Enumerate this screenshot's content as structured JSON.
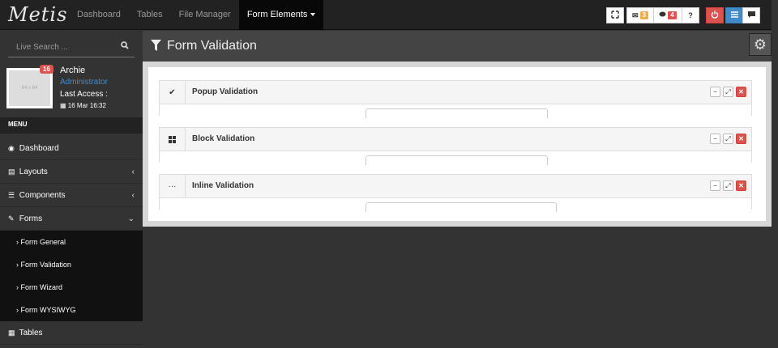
{
  "brand": {
    "logo_text": "Metis"
  },
  "nav": {
    "links": [
      {
        "label": "Dashboard"
      },
      {
        "label": "Tables"
      },
      {
        "label": "File Manager"
      },
      {
        "label": "Form Elements"
      }
    ],
    "toolbar": {
      "mail_count": "3",
      "comment_count": "4",
      "help_label": "?"
    }
  },
  "sidebar": {
    "search_placeholder": "Live Search ...",
    "user": {
      "name": "Archie",
      "role": "Administrator",
      "last_access_label": "Last Access :",
      "date": "16 Mar 16:32",
      "notification_count": "16",
      "avatar_text": "64 x 64"
    },
    "menu_header": "MENU",
    "items": [
      {
        "label": "Dashboard",
        "icon": "dashboard-icon"
      },
      {
        "label": "Layouts",
        "icon": "layouts-icon"
      },
      {
        "label": "Components",
        "icon": "components-icon"
      },
      {
        "label": "Forms",
        "icon": "pencil-icon"
      },
      {
        "label": "Tables",
        "icon": "table-icon"
      }
    ],
    "forms_submenu": [
      {
        "label": "Form General"
      },
      {
        "label": "Form Validation"
      },
      {
        "label": "Form Wizard"
      },
      {
        "label": "Form WYSIWYG"
      }
    ]
  },
  "main": {
    "title": "Form Validation",
    "boxes": [
      {
        "title": "Popup Validation",
        "icon": "check-icon"
      },
      {
        "title": "Block Validation",
        "icon": "grid-icon"
      },
      {
        "title": "Inline Validation",
        "icon": "ellipsis-icon"
      }
    ]
  },
  "colors": {
    "navbar": "#222222",
    "sidebar": "#333333",
    "accent_blue": "#428bca",
    "danger": "#d9534f",
    "warning": "#f0ad4e"
  }
}
